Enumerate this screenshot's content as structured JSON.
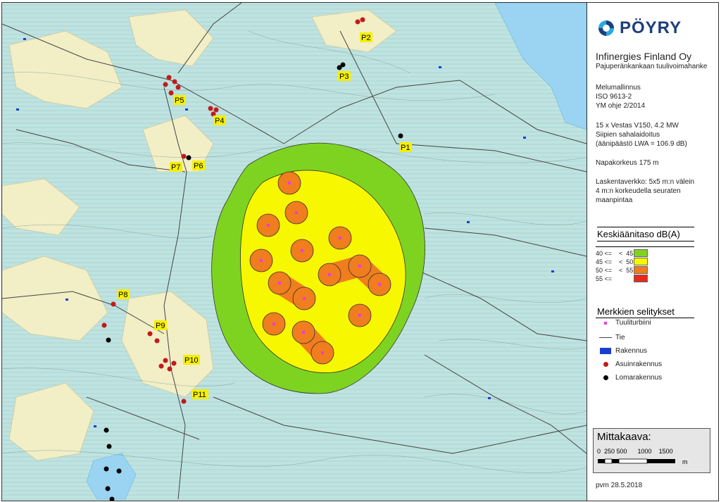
{
  "map": {
    "point_labels": [
      "P1",
      "P2",
      "P3",
      "P4",
      "P5",
      "P6",
      "P7",
      "P8",
      "P9",
      "P10",
      "P11"
    ],
    "colors": {
      "level_40_45": "#7ed321",
      "level_45_50": "#f7f700",
      "level_50_55": "#f07d1e",
      "level_55": "#e8291c",
      "turbine": "#e83ce8",
      "terrain_light": "#bfe3e0",
      "terrain_land": "#f5efc5",
      "water": "#9ad4f2"
    }
  },
  "panel": {
    "logo_text": "PÖYRY",
    "company": "Infinergies Finland Oy",
    "project": "Pajuperänkankaan tuulivoimahanke",
    "modeling_lines": [
      "Melumallinnus",
      "ISO 9613-2",
      "YM ohje 2/2014"
    ],
    "turbine_lines": [
      "15 x Vestas V150, 4.2 MW",
      "Siipien sahalaidoitus",
      "(äänipäästö LWA = 106.9 dB)"
    ],
    "hub_height": "Napakorkeus 175 m",
    "grid_lines": [
      "Laskentaverkko: 5x5 m:n välein",
      "4 m:n korkeudella seuraten",
      "maanpintaa"
    ],
    "levels_heading": "Keskiäänitaso dB(A)",
    "levels": [
      {
        "range": "40 <=    <  45",
        "color": "#7ed321"
      },
      {
        "range": "45 <=    <  50",
        "color": "#f7f700"
      },
      {
        "range": "50 <=    <  55",
        "color": "#f07d1e"
      },
      {
        "range": "55 <=",
        "color": "#e8291c"
      }
    ],
    "symbols_heading": "Merkkien selitykset",
    "symbols": [
      {
        "label": "Tuuliturbiini",
        "icon": "turbine-icon"
      },
      {
        "label": "Tie",
        "icon": "road-icon"
      },
      {
        "label": "Rakennus",
        "icon": "building-icon"
      },
      {
        "label": "Asuinrakennus",
        "icon": "residence-icon"
      },
      {
        "label": "Lomarakennus",
        "icon": "holiday-home-icon"
      }
    ],
    "scale_title": "Mittakaava:",
    "scale_ticks": "0  250 500      1000    1500",
    "scale_unit": "m",
    "date": "pvm 28.5.2018"
  }
}
